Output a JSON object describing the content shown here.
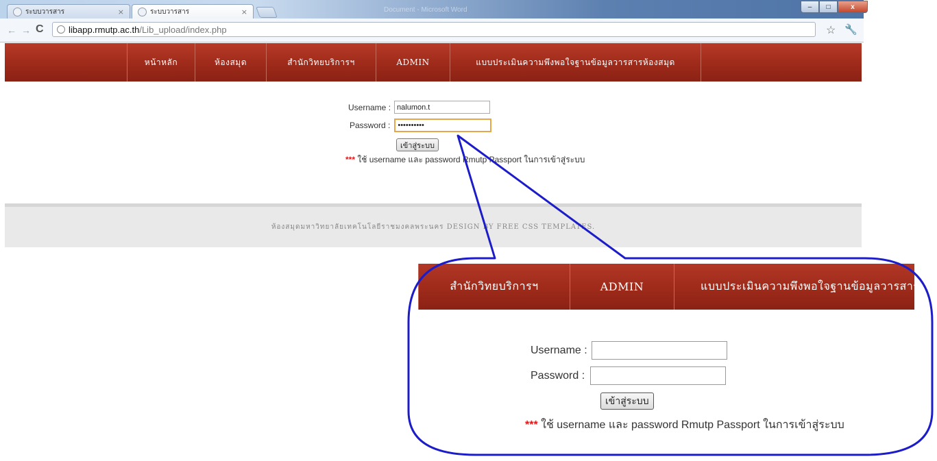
{
  "browser": {
    "tabs": [
      {
        "title": "ระบบวารสาร",
        "close": "×"
      },
      {
        "title": "ระบบวารสาร",
        "close": "×"
      }
    ],
    "background_window_title": "Document - Microsoft Word",
    "url_host": "libapp.rmutp.ac.th",
    "url_path": "/Lib_upload/index.php",
    "window_controls": {
      "minimize": "–",
      "maximize": "□",
      "close": "x"
    }
  },
  "site": {
    "nav": [
      {
        "label": "หน้าหลัก"
      },
      {
        "label": "ห้องสมุด"
      },
      {
        "label": "สำนักวิทยบริการฯ"
      },
      {
        "label": "ADMIN"
      },
      {
        "label": "แบบประเมินความพึงพอใจฐานข้อมูลวารสารห้องสมุด"
      }
    ],
    "login": {
      "username_label": "Username :",
      "username_value": "nalumon.t",
      "password_label": "Password :",
      "password_value": "••••••••••",
      "submit_label": "เข้าสู่ระบบ",
      "note_stars": "***",
      "note_text": " ใช้ username และ password Rmutp Passport ในการเข้าสู่ระบบ"
    },
    "footer": "ห้องสมุดมหาวิทยาลัยเทคโนโลยีราชมงคลพระนคร DESIGN BY FREE CSS TEMPLATES."
  },
  "zoom": {
    "nav": [
      {
        "label": "สำนักวิทยบริการฯ"
      },
      {
        "label": "ADMIN"
      },
      {
        "label": "แบบประเมินความพึงพอใจฐานข้อมูลวารสารห้องสมุด"
      }
    ],
    "username_label": "Username :",
    "password_label": "Password :",
    "submit_label": "เข้าสู่ระบบ",
    "note_stars": "***",
    "note_text": " ใช้ username และ password Rmutp Passport ในการเข้าสู่ระบบ"
  },
  "colors": {
    "nav_red": "#9e2a1a",
    "callout_blue": "#1c1cc8",
    "note_red": "#e01818",
    "focus_orange": "#e6a64a"
  }
}
